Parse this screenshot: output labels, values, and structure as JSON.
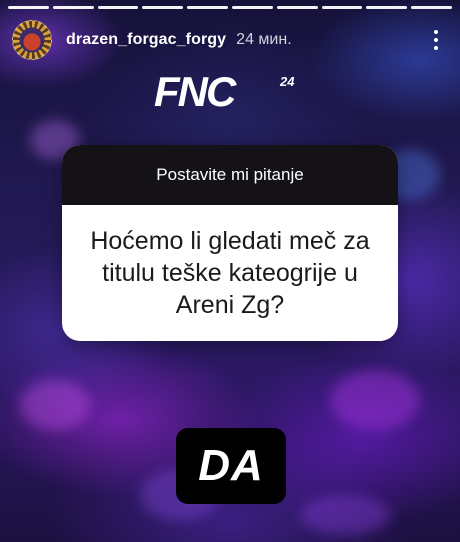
{
  "story": {
    "progress_segments": 10,
    "username": "drazen_forgac_forgy",
    "time_ago": "24 мин.",
    "more_icon": "more-vertical-icon"
  },
  "logo": {
    "text": "FNC",
    "superscript": "24"
  },
  "question_sticker": {
    "header": "Postavite mi pitanje",
    "question": "Hoćemo li gledati meč za titulu teške kateogrije u Areni Zg?"
  },
  "answer_sticker": {
    "text": "DA"
  },
  "colors": {
    "card_header_bg": "#141217",
    "card_body_bg": "#ffffff",
    "answer_bg": "#000000",
    "accent_background": "#2b1863"
  }
}
